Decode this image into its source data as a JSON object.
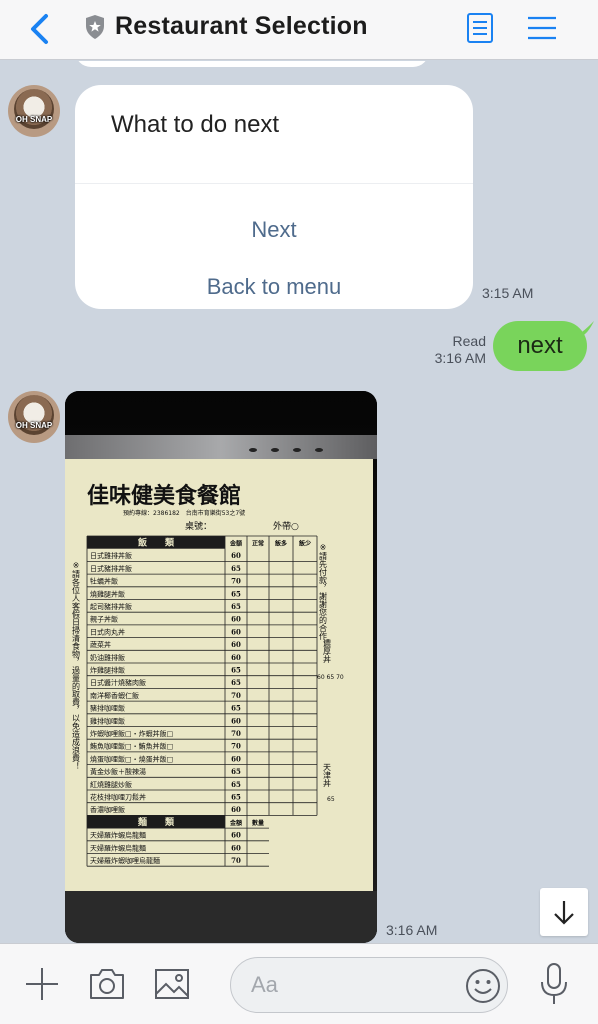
{
  "header": {
    "title": "Restaurant Selection",
    "back_icon": "chevron-left-icon",
    "shield_icon": "shield-icon",
    "note_icon": "note-icon",
    "menu_icon": "hamburger-menu-icon"
  },
  "messages": {
    "card": {
      "title": "What to do next",
      "buttons": [
        "Next",
        "Back to menu"
      ],
      "time": "3:15 AM"
    },
    "outgoing": {
      "text": "next",
      "read_label": "Read",
      "time": "3:16 AM"
    },
    "photo": {
      "time": "3:16 AM",
      "menu_header": "佳味健美食餐館",
      "table_label": "桌號：",
      "takeout_label": "外帶○",
      "phone_line": "預約專線：2386182　台南市育樂街53之7號",
      "rice_header": [
        "飯　　類",
        "金額",
        "正常",
        "飯多",
        "飯少"
      ],
      "rice_items": [
        [
          "日式雞排丼飯",
          "60"
        ],
        [
          "日式豬排丼飯",
          "65"
        ],
        [
          "牡蠣丼飯",
          "70"
        ],
        [
          "燒雞腿丼飯",
          "65"
        ],
        [
          "起司豬排丼飯",
          "65"
        ],
        [
          "親子丼飯",
          "60"
        ],
        [
          "日式肉丸丼",
          "60"
        ],
        [
          "蔬菜丼",
          "60"
        ],
        [
          "奶油雞排飯",
          "60"
        ],
        [
          "炸雞腿排飯",
          "65"
        ],
        [
          "日式醬汁燒豬肉飯",
          "65"
        ],
        [
          "南洋椰香蝦仁飯",
          "70"
        ],
        [
          "豬排咖哩飯",
          "65"
        ],
        [
          "雞排咖哩飯",
          "60"
        ],
        [
          "炸蝦咖哩飯□・炸蝦丼飯□",
          "70"
        ],
        [
          "鮪魚咖哩飯□・鮪魚丼飯□",
          "70"
        ],
        [
          "燒蛋咖哩飯□・燒蛋丼飯□",
          "60"
        ],
        [
          "黃金炒飯＋酸辣湯",
          "65"
        ],
        [
          "紅燒雞腿炒飯",
          "65"
        ],
        [
          "花枝排咖哩刀鬆丼",
          "65"
        ],
        [
          "香濃咖哩飯",
          "60"
        ]
      ],
      "noodle_header": [
        "麵　　類",
        "金額",
        "數量"
      ],
      "noodle_items": [
        [
          "天婦羅炸蝦烏龍麵",
          "60"
        ],
        [
          "天婦羅炸蝦烏龍麵",
          "60"
        ],
        [
          "天婦羅炸蝦咖哩烏龍麵",
          "70"
        ]
      ],
      "side_note_left": "※請各位人客假日掃清食物，過量的取費，以免造成浪費！",
      "side_note_right": "※請先付款，謝謝您的合作！",
      "side_special_1": "濃厚丼",
      "side_special_1_prices": "60 65 70",
      "side_special_2": "天津丼",
      "side_special_2_price": "65"
    }
  },
  "avatars": {
    "caption": "OH SNAP"
  },
  "composer": {
    "placeholder": "Aa",
    "add_icon": "plus-icon",
    "camera_icon": "camera-icon",
    "image_icon": "image-icon",
    "emoji_icon": "smiley-icon",
    "mic_icon": "microphone-icon"
  },
  "scroll_icon": "arrow-down-icon",
  "colors": {
    "background": "#cdd5df",
    "accent_blue": "#1a82f2",
    "outgoing_bubble": "#79d45b",
    "card_button_text": "#4f6b8c"
  }
}
